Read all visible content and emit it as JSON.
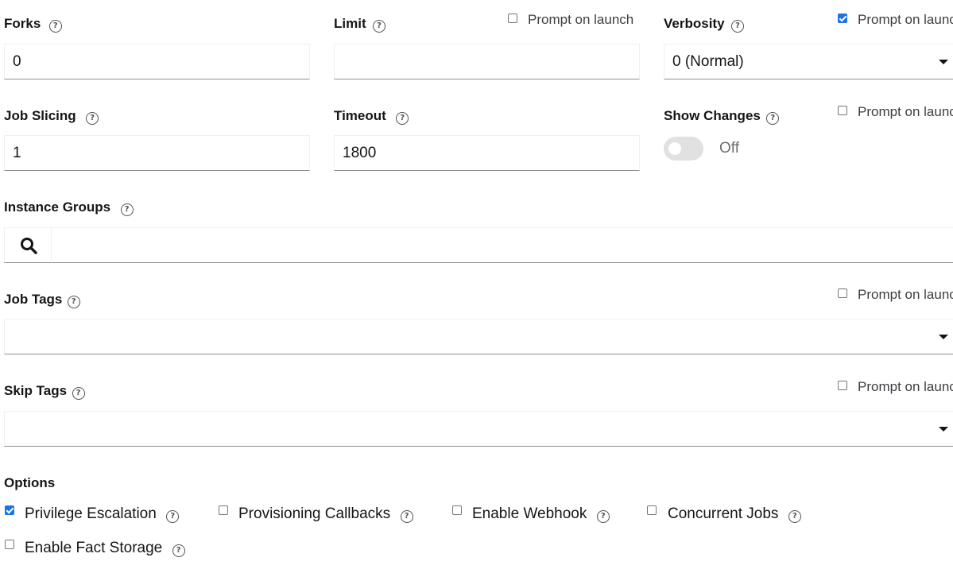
{
  "fields": {
    "forks": {
      "label": "Forks",
      "value": "0"
    },
    "limit": {
      "label": "Limit",
      "value": "",
      "prompt_label": "Prompt on launch",
      "prompt_checked": false
    },
    "verbosity": {
      "label": "Verbosity",
      "value": "0 (Normal)",
      "prompt_label": "Prompt on launch",
      "prompt_checked": true
    },
    "job_slicing": {
      "label": "Job Slicing",
      "value": "1"
    },
    "timeout": {
      "label": "Timeout",
      "value": "1800"
    },
    "show_changes": {
      "label": "Show Changes",
      "state_label": "Off",
      "enabled": false,
      "prompt_label": "Prompt on launch",
      "prompt_checked": false
    },
    "instance_groups": {
      "label": "Instance Groups",
      "value": ""
    },
    "job_tags": {
      "label": "Job Tags",
      "value": "",
      "prompt_label": "Prompt on launch",
      "prompt_checked": false
    },
    "skip_tags": {
      "label": "Skip Tags",
      "value": "",
      "prompt_label": "Prompt on launch",
      "prompt_checked": false
    }
  },
  "help_glyph": "?",
  "options": {
    "label": "Options",
    "items": [
      {
        "label": "Privilege Escalation",
        "checked": true
      },
      {
        "label": "Provisioning Callbacks",
        "checked": false
      },
      {
        "label": "Enable Webhook",
        "checked": false
      },
      {
        "label": "Concurrent Jobs",
        "checked": false
      },
      {
        "label": "Enable Fact Storage",
        "checked": false
      }
    ]
  },
  "icons": {
    "help": "help-circle-icon",
    "search": "search-icon",
    "dropdown": "caret-down-icon"
  },
  "colors": {
    "checkbox_checked": "#1a73e8",
    "toggle_off": "#e1e1e1",
    "input_border": "#8a8d90"
  }
}
